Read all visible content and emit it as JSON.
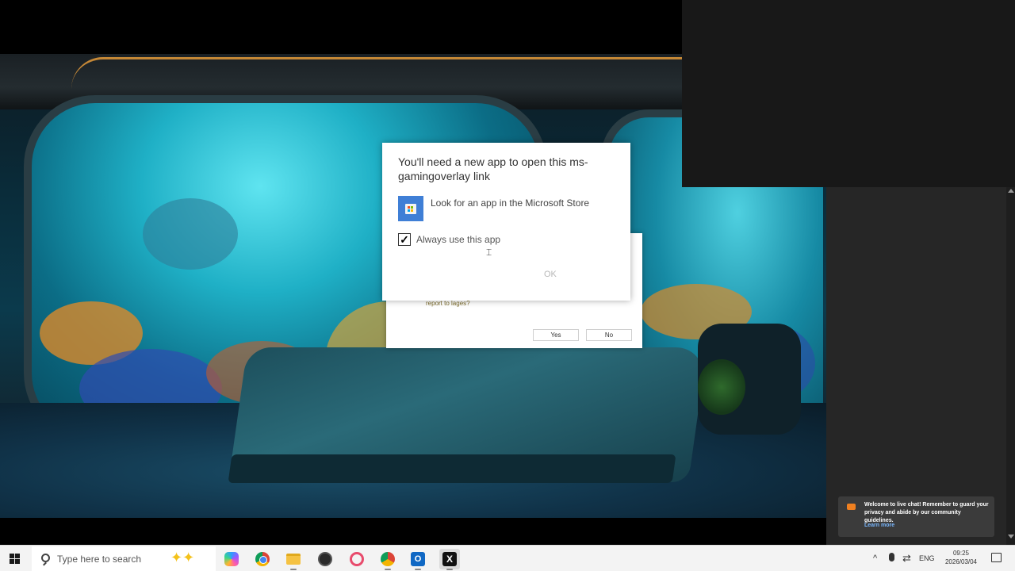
{
  "dialog": {
    "title": "You'll need a new app to open this ms-gamingoverlay link",
    "store_option": "Look for an app in the Microsoft Store",
    "always_use_label": "Always use this app",
    "always_use_checked": true,
    "ok_label": "OK"
  },
  "dialog_back": {
    "text": "report to lages?",
    "yes_label": "Yes",
    "no_label": "No"
  },
  "toast": {
    "message": "Welcome to live chat! Remember to guard your privacy and abide by our community guidelines.",
    "link": "Learn more"
  },
  "taskbar": {
    "search_placeholder": "Type here to search",
    "apps": [
      "copilot-icon",
      "chrome-icon",
      "file-explorer-icon",
      "obs-icon",
      "snipping-tool-icon",
      "chrome-icon",
      "outlook-icon",
      "capcut-icon"
    ],
    "outlook_glyph": "O",
    "capcut_glyph": "X"
  },
  "tray": {
    "chevron": "^",
    "language": "ENG",
    "time": "09:25",
    "date": "2026/03/04"
  },
  "colors": {
    "accent": "#3f7fd6",
    "toast_bg": "#3b3b3b",
    "link": "#7ab8ff"
  }
}
